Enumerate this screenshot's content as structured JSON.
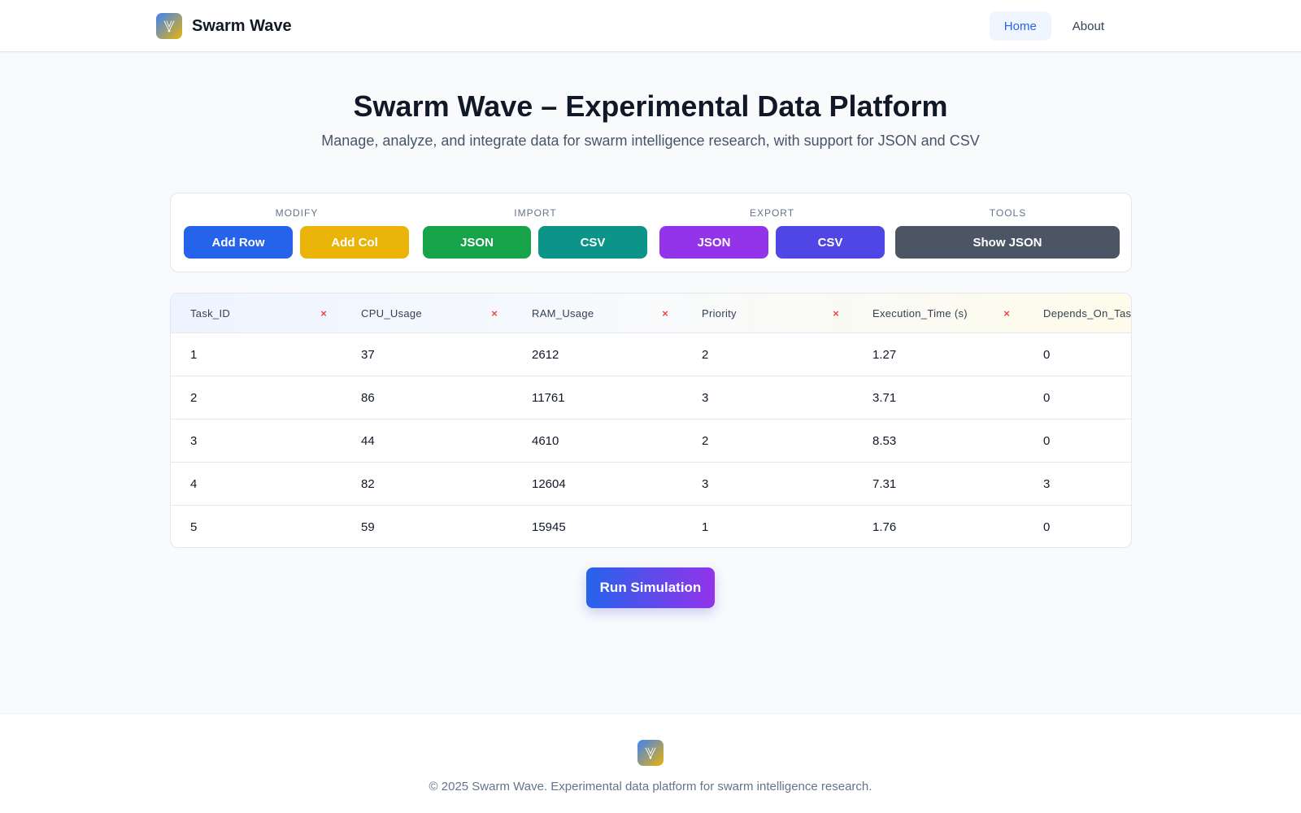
{
  "header": {
    "brand": "Swarm Wave",
    "nav": [
      {
        "label": "Home",
        "active": true
      },
      {
        "label": "About",
        "active": false
      }
    ]
  },
  "hero": {
    "title": "Swarm Wave – Experimental Data Platform",
    "subtitle": "Manage, analyze, and integrate data for swarm intelligence research, with support for JSON and CSV"
  },
  "toolbar": {
    "groups": [
      {
        "label": "MODIFY",
        "buttons": [
          {
            "label": "Add Row",
            "color": "#2563eb"
          },
          {
            "label": "Add Col",
            "color": "#eab308"
          }
        ]
      },
      {
        "label": "IMPORT",
        "buttons": [
          {
            "label": "JSON",
            "color": "#16a34a"
          },
          {
            "label": "CSV",
            "color": "#0d9488"
          }
        ]
      },
      {
        "label": "EXPORT",
        "buttons": [
          {
            "label": "JSON",
            "color": "#9333ea"
          },
          {
            "label": "CSV",
            "color": "#4f46e5"
          }
        ]
      },
      {
        "label": "TOOLS",
        "buttons": [
          {
            "label": "Show JSON",
            "color": "#4b5563"
          }
        ]
      }
    ]
  },
  "table": {
    "delete_glyph": "×",
    "columns": [
      "Task_ID",
      "CPU_Usage",
      "RAM_Usage",
      "Priority",
      "Execution_Time (s)",
      "Depends_On_Tas"
    ],
    "rows": [
      [
        "1",
        "37",
        "2612",
        "2",
        "1.27",
        "0"
      ],
      [
        "2",
        "86",
        "11761",
        "3",
        "3.71",
        "0"
      ],
      [
        "3",
        "44",
        "4610",
        "2",
        "8.53",
        "0"
      ],
      [
        "4",
        "82",
        "12604",
        "3",
        "7.31",
        "3"
      ],
      [
        "5",
        "59",
        "15945",
        "1",
        "1.76",
        "0"
      ]
    ]
  },
  "actions": {
    "run_label": "Run Simulation"
  },
  "footer": {
    "text": "© 2025 Swarm Wave. Experimental data platform for swarm intelligence research."
  },
  "icons": {
    "logo": "swarm-logo-icon",
    "column_delete": "close-icon"
  },
  "colors": {
    "accent": "#2563eb",
    "run_gradient_start": "#2563eb",
    "run_gradient_end": "#9333ea",
    "delete": "#ef4444"
  }
}
